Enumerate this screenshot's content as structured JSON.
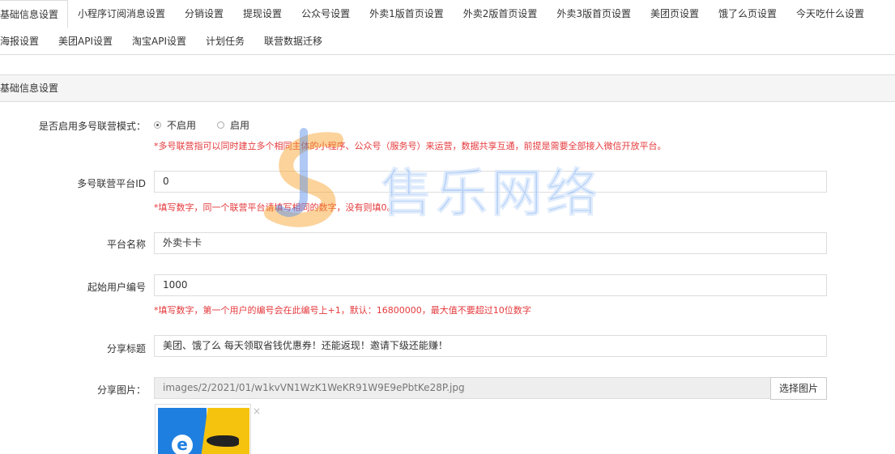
{
  "tabs": {
    "row1": [
      "基础信息设置",
      "小程序订阅消息设置",
      "分销设置",
      "提现设置",
      "公众号设置",
      "外卖1版首页设置",
      "外卖2版首页设置",
      "外卖3版首页设置",
      "美团页设置",
      "饿了么页设置",
      "今天吃什么设置"
    ],
    "row2": [
      "海报设置",
      "美团API设置",
      "淘宝API设置",
      "计划任务",
      "联营数据迁移"
    ],
    "active": "基础信息设置"
  },
  "panel": {
    "title": "基础信息设置"
  },
  "form": {
    "multi_mode": {
      "label": "是否启用多号联营模式：",
      "options": [
        "不启用",
        "启用"
      ],
      "selected": "不启用",
      "help": "*多号联营指可以同时建立多个相同主体的小程序、公众号（服务号）来运营，数据共享互通，前提是需要全部接入微信开放平台。"
    },
    "platform_id": {
      "label": "多号联营平台ID",
      "value": "0",
      "help": "*填写数字，同一个联营平台请填写相同的数字，没有则填0。"
    },
    "platform_name": {
      "label": "平台名称",
      "value": "外卖卡卡"
    },
    "start_user_no": {
      "label": "起始用户编号",
      "value": "1000",
      "help": "*填写数字，第一个用户的编号会在此编号上+1，默认：16800000，最大值不要超过10位数字"
    },
    "share_title": {
      "label": "分享标题",
      "value": "美团、饿了么 每天领取省钱优惠券！还能返现！邀请下级还能赚！"
    },
    "share_image": {
      "label": "分享图片：",
      "path": "images/2/2021/01/w1kvVN1WzK1WeKR91W9E9ePbtKe28P.jpg",
      "button": "选择图片",
      "close": "×",
      "thumb_letter": "e"
    }
  },
  "watermark": {
    "text": "售乐网络"
  },
  "colors": {
    "help_red": "#e4393c",
    "accent_blue": "#1f7fe0",
    "accent_yellow": "#f5c20e"
  },
  "icons": {
    "close": "close-icon",
    "radio": "radio-icon"
  }
}
